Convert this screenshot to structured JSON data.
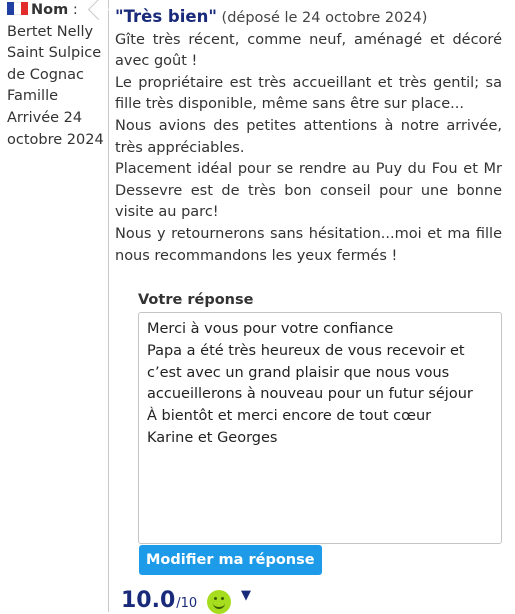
{
  "reviewer": {
    "flag_colors": [
      "#1f3fa3",
      "#ffffff",
      "#e22b2b"
    ],
    "nom_label": "Nom",
    "colon": " :",
    "name": "Bertet Nelly",
    "location": "Saint Sulpice de Cognac",
    "group": "Famille",
    "arrival": "Arrivée 24 octobre 2024"
  },
  "review": {
    "title": "\"Très bien\"",
    "date": "(déposé le 24 octobre 2024)",
    "paragraphs": [
      "Gîte très récent, comme neuf, aménagé et décoré avec goût !",
      "Le propriétaire est très accueillant et très gentil; sa fille très disponible, même sans être sur place...",
      "Nous avions des petites attentions à notre arrivée, très appréciables.",
      "Placement idéal pour se rendre au Puy du Fou et Mr Dessevre est de très bon conseil pour une bonne visite au parc!",
      "Nous y retournerons sans hésitation...moi et ma fille nous recommandons les yeux fermés !"
    ]
  },
  "response": {
    "label": "Votre réponse",
    "text": "Merci à vous pour votre confiance\nPapa a été très heureux de vous recevoir et c’est avec un grand plaisir que nous vous accueillerons à nouveau pour un futur séjour\nÀ bientôt et merci encore de tout cœur\nKarine et Georges",
    "button_label": "Modifier ma réponse"
  },
  "rating": {
    "score": "10.0",
    "denominator": "/10",
    "icon": "smiley-icon",
    "toggle_icon": "▼"
  }
}
